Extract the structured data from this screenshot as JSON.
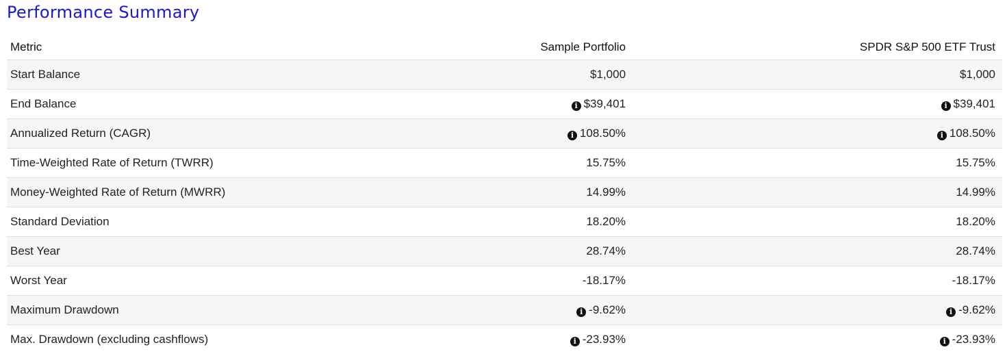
{
  "title": "Performance Summary",
  "columns": {
    "metric": "Metric",
    "portfolio": "Sample Portfolio",
    "benchmark": "SPDR S&P 500 ETF Trust"
  },
  "rows": [
    {
      "metric": "Start Balance",
      "portfolio": "$1,000",
      "benchmark": "$1,000",
      "info": false
    },
    {
      "metric": "End Balance",
      "portfolio": "$39,401",
      "benchmark": "$39,401",
      "info": true
    },
    {
      "metric": "Annualized Return (CAGR)",
      "portfolio": "108.50%",
      "benchmark": "108.50%",
      "info": true
    },
    {
      "metric": "Time-Weighted Rate of Return (TWRR)",
      "portfolio": "15.75%",
      "benchmark": "15.75%",
      "info": false
    },
    {
      "metric": "Money-Weighted Rate of Return (MWRR)",
      "portfolio": "14.99%",
      "benchmark": "14.99%",
      "info": false
    },
    {
      "metric": "Standard Deviation",
      "portfolio": "18.20%",
      "benchmark": "18.20%",
      "info": false
    },
    {
      "metric": "Best Year",
      "portfolio": "28.74%",
      "benchmark": "28.74%",
      "info": false
    },
    {
      "metric": "Worst Year",
      "portfolio": "-18.17%",
      "benchmark": "-18.17%",
      "info": false
    },
    {
      "metric": "Maximum Drawdown",
      "portfolio": "-9.62%",
      "benchmark": "-9.62%",
      "info": true
    },
    {
      "metric": "Max. Drawdown (excluding cashflows)",
      "portfolio": "-23.93%",
      "benchmark": "-23.93%",
      "info": true
    }
  ],
  "icons": {
    "info": "info-circle-icon"
  },
  "colors": {
    "title": "#1b17d6",
    "stripe": "#f6f6f6",
    "divider": "#dedede"
  }
}
